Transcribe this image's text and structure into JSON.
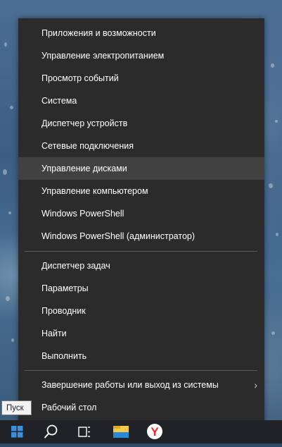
{
  "menu": {
    "group1": [
      "Приложения и возможности",
      "Управление электропитанием",
      "Просмотр событий",
      "Система",
      "Диспетчер устройств",
      "Сетевые подключения",
      "Управление дисками",
      "Управление компьютером",
      "Windows PowerShell",
      "Windows PowerShell (администратор)"
    ],
    "group2": [
      "Диспетчер задач",
      "Параметры",
      "Проводник",
      "Найти",
      "Выполнить"
    ],
    "group3": [
      "Завершение работы или выход из системы",
      "Рабочий стол"
    ],
    "highlighted": "Управление дисками",
    "submenu_arrow": "›"
  },
  "tooltip": {
    "text": "Пуск"
  },
  "taskbar": {
    "icons": [
      "windows-start-icon",
      "search-icon",
      "task-view-icon",
      "file-explorer-icon",
      "yandex-browser-icon"
    ],
    "yandex_letter": "Y"
  },
  "colors": {
    "menu_bg": "#2b2b2b",
    "menu_highlight": "#414141",
    "start_blue": "#3a8fde",
    "yandex_red": "#ff1f1f",
    "explorer_yellow": "#f7c948"
  }
}
